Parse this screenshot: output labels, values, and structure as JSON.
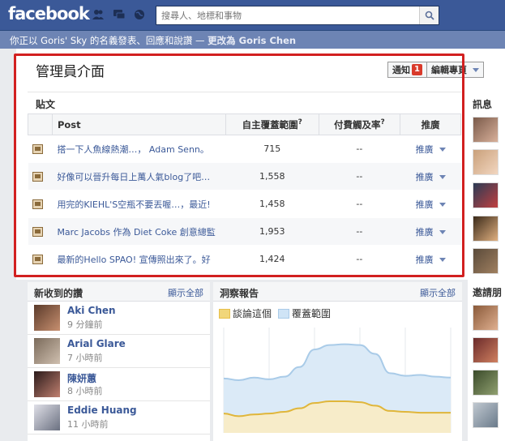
{
  "header": {
    "logo": "facebook",
    "search_placeholder": "搜尋人、地標和事物"
  },
  "subbar": {
    "text": "你正以 Goris' Sky 的名義發表、回應和說讚 — ",
    "switch_link": "更改為 Goris Chen"
  },
  "admin": {
    "title": "管理員介面",
    "notifications_label": "通知",
    "notifications_count": "1",
    "edit_page_label": "編輯專頁"
  },
  "posts": {
    "section_label": "貼文",
    "columns": [
      "Post",
      "自主覆蓋範圍",
      "付費觸及率",
      "推廣"
    ],
    "rows": [
      {
        "text": "搭一下人魚線熱潮…， Adam Senn。",
        "reach": "715",
        "paid": "--",
        "promote": "推廣"
      },
      {
        "text": "好像可以晉升每日上萬人氣blog了吧…",
        "reach": "1,558",
        "paid": "--",
        "promote": "推廣"
      },
      {
        "text": "用完的KIEHL'S空瓶不要丟喔…，最近!",
        "reach": "1,458",
        "paid": "--",
        "promote": "推廣"
      },
      {
        "text": "Marc Jacobs 作為 Diet Coke 創意總監",
        "reach": "1,953",
        "paid": "--",
        "promote": "推廣"
      },
      {
        "text": "最新的Hello SPAO! 宣傳照出來了。好",
        "reach": "1,424",
        "paid": "--",
        "promote": "推廣"
      }
    ]
  },
  "right_sidebar": {
    "messages_label": "訊息",
    "invite_label": "邀請朋"
  },
  "new_likes": {
    "title": "新收到的讚",
    "show_all": "顯示全部",
    "items": [
      {
        "name": "Aki Chen",
        "time": "9 分鐘前"
      },
      {
        "name": "Arial Glare",
        "time": "7 小時前"
      },
      {
        "name": "陳妍蕙",
        "time": "8 小時前"
      },
      {
        "name": "Eddie Huang",
        "time": "11 小時前"
      }
    ]
  },
  "insights": {
    "title": "洞察報告",
    "show_all": "顯示全部",
    "legend": [
      {
        "name": "談論這個",
        "color": "#e8c04a"
      },
      {
        "name": "覆蓋範圍",
        "color": "#b6d7f2"
      }
    ]
  },
  "chart_data": {
    "type": "area",
    "series": [
      {
        "name": "覆蓋範圍",
        "values": [
          62,
          60,
          63,
          61,
          64,
          75,
          95,
          100,
          101,
          100,
          90,
          68,
          65,
          66,
          64,
          63
        ]
      },
      {
        "name": "談論這個",
        "values": [
          22,
          19,
          21,
          22,
          24,
          28,
          34,
          36,
          36,
          35,
          31,
          25,
          24,
          23,
          23,
          23
        ]
      }
    ],
    "ylim": [
      0,
      120
    ]
  },
  "colors": {
    "brand": "#3b5998",
    "highlight_frame": "#d22020",
    "badge": "#d93a2b"
  }
}
